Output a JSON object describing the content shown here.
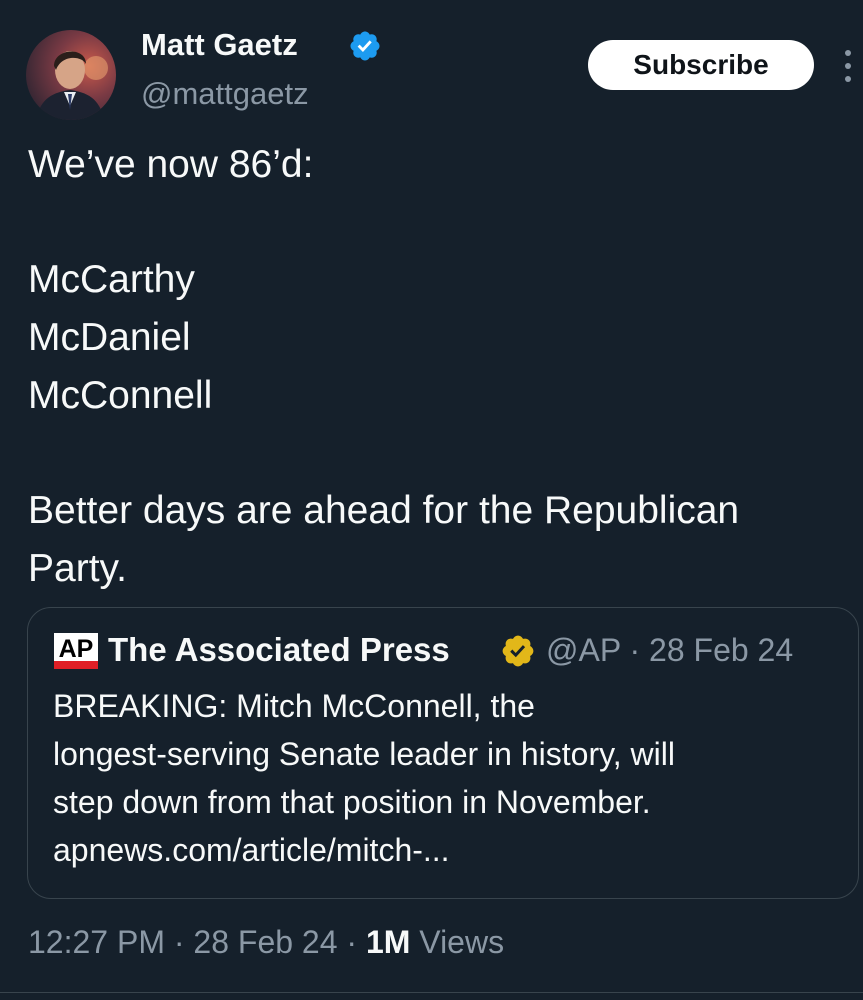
{
  "author": {
    "name": "Matt Gaetz",
    "handle": "@mattgaetz",
    "verified_color": "#1d9bf0"
  },
  "subscribe_label": "Subscribe",
  "tweet_lines": [
    "We’ve now 86’d:",
    "McCarthy",
    "McDaniel",
    "McConnell",
    "Better days are ahead for the Republican",
    "Party."
  ],
  "quoted_tweet": {
    "logo_text": "AP",
    "name": "The Associated Press",
    "badge_color": "#e2b719",
    "handle": "@AP",
    "separator": "·",
    "date": "28 Feb 24",
    "lines": [
      "BREAKING: Mitch McConnell, the",
      "longest-serving Senate leader in history, will",
      "step down from that position in November.",
      "apnews.com/article/mitch-..."
    ]
  },
  "footer": {
    "time": "12:27 PM",
    "separator": "·",
    "date": "28 Feb 24",
    "views_count": "1M",
    "views_label": "Views"
  },
  "icons": [
    "verified-badge-icon",
    "more-options-icon",
    "ap-logo-icon",
    "gold-verified-badge-icon"
  ]
}
